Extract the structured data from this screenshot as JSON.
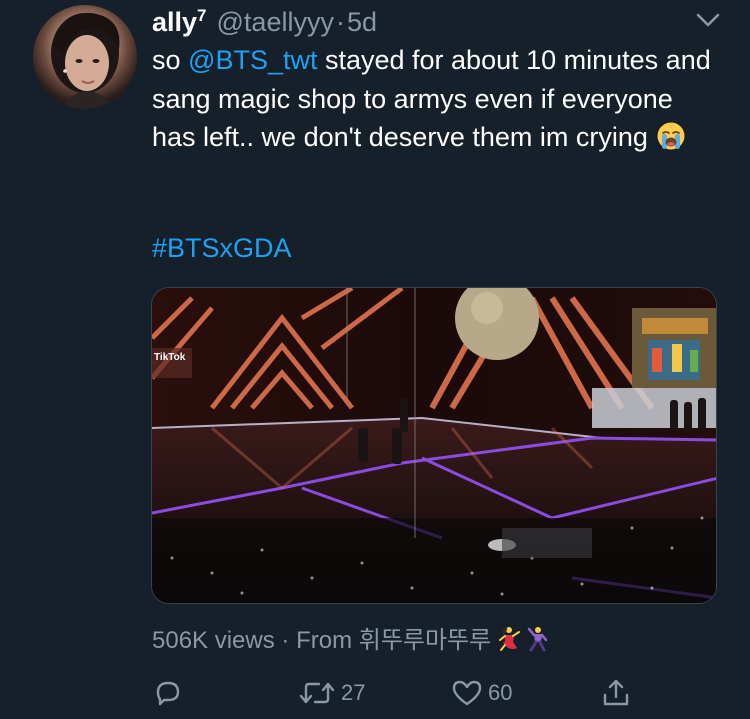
{
  "tweet": {
    "display_name": "ally",
    "name_superscript": "7",
    "handle": "@taellyyy",
    "separator": "·",
    "time": "5d",
    "text_prefix": "so ",
    "mention": "@BTS_twt",
    "text_rest": " stayed for about 10 minutes and sang magic shop to armys even if everyone has left.. we don't deserve them im crying",
    "emoji": "loudly-crying-face",
    "hashtag": "#BTSxGDA"
  },
  "media": {
    "overlay_text": "TikTok"
  },
  "meta": {
    "views": "506K views",
    "from_label": "· From",
    "source": "휘뚜루마뚜루",
    "source_emojis": [
      "dancing-woman",
      "dancing-man"
    ]
  },
  "actions": {
    "reply_count": "",
    "retweet_count": "27",
    "like_count": "60"
  },
  "colors": {
    "background": "#15202b",
    "text": "#ffffff",
    "secondary": "#8899a6",
    "accent": "#1da1f2"
  }
}
